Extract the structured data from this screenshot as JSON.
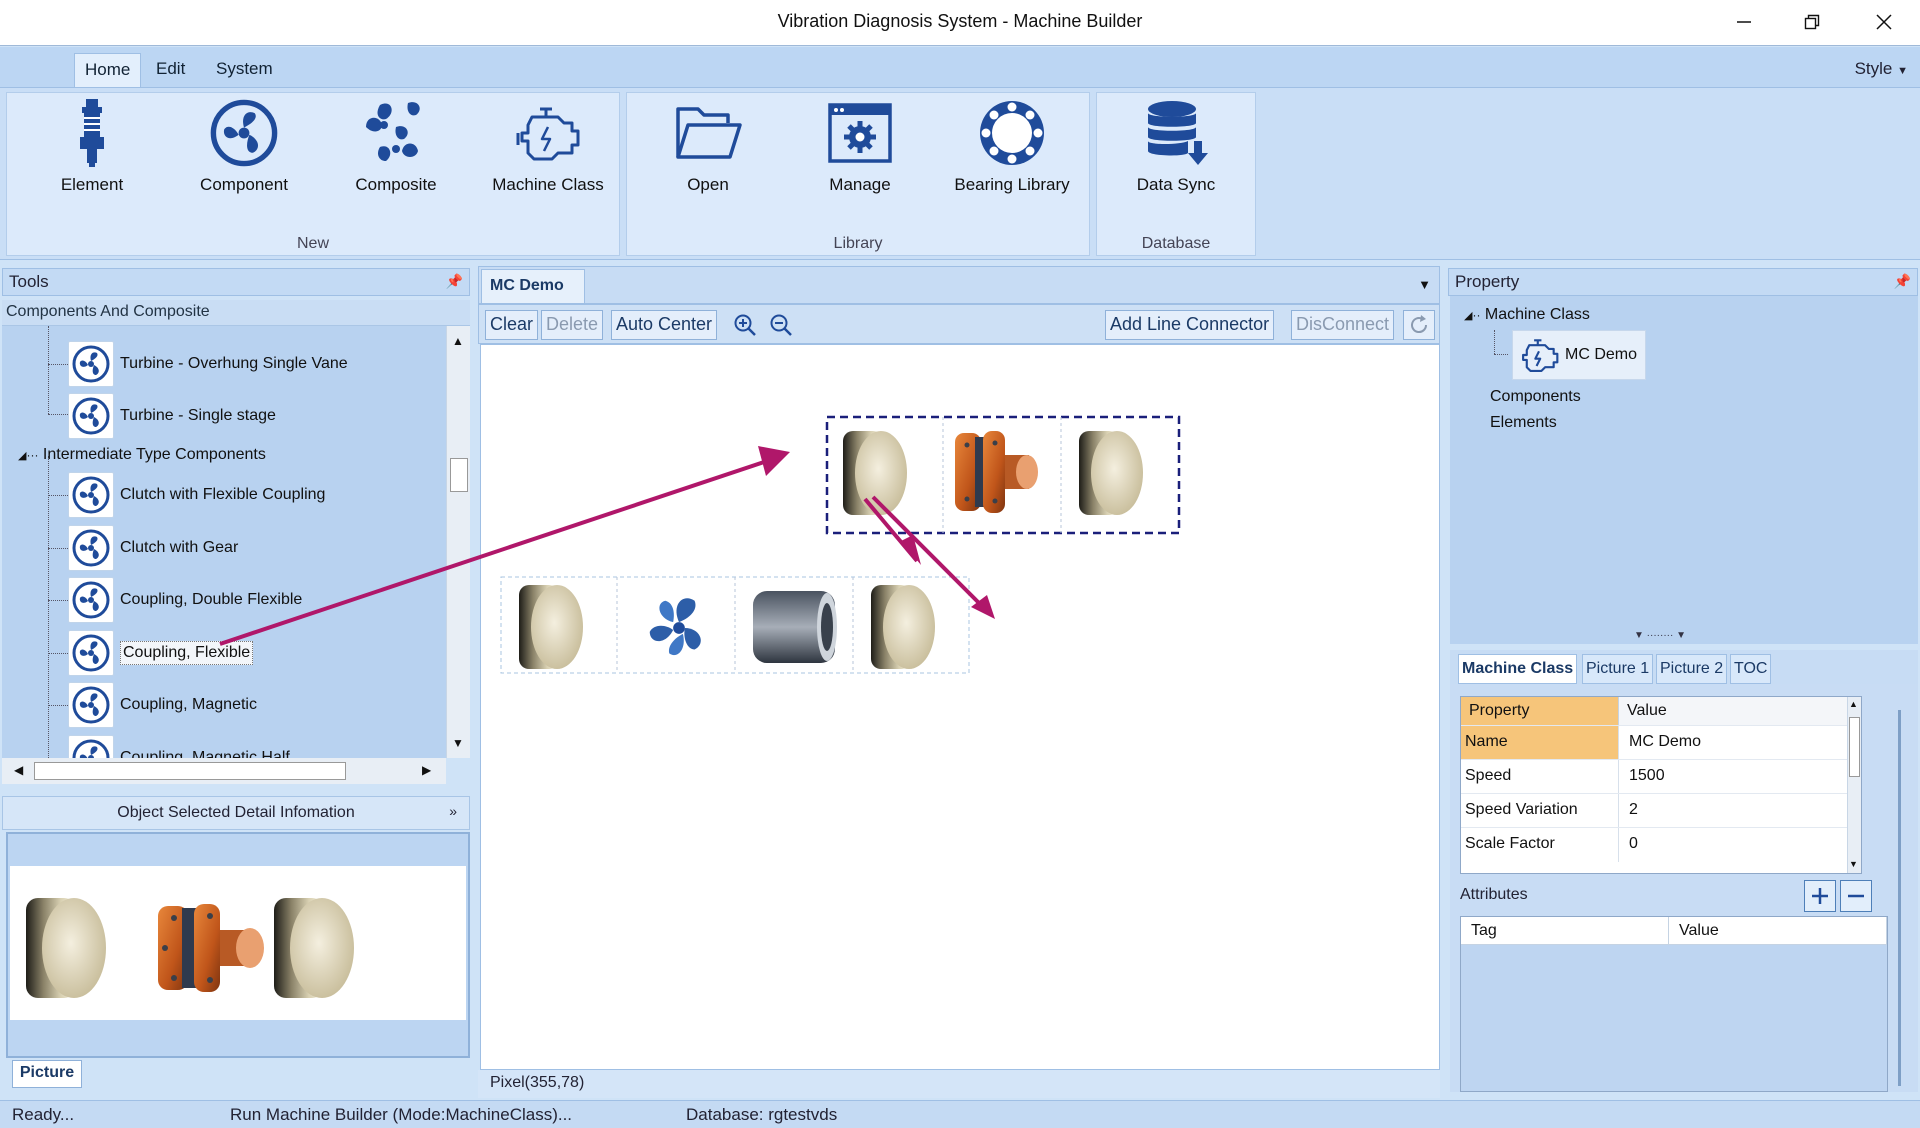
{
  "window": {
    "title": "Vibration Diagnosis System - Machine Builder"
  },
  "ribbon": {
    "tabs": [
      "Home",
      "Edit",
      "System"
    ],
    "style_label": "Style",
    "groups": [
      {
        "label": "New",
        "buttons": [
          "Element",
          "Component",
          "Composite",
          "Machine Class"
        ]
      },
      {
        "label": "Library",
        "buttons": [
          "Open",
          "Manage",
          "Bearing Library"
        ]
      },
      {
        "label": "Database",
        "buttons": [
          "Data Sync"
        ]
      }
    ]
  },
  "tools": {
    "title": "Tools",
    "section": "Components And Composite",
    "items": [
      "Turbine - Overhung Single Vane",
      "Turbine - Single stage",
      "Intermediate Type Components",
      "Clutch with Flexible Coupling",
      "Clutch with Gear",
      "Coupling, Double Flexible",
      "Coupling, Flexible",
      "Coupling, Magnetic",
      "Coupling, Magnetic Half"
    ],
    "selected_item": "Coupling, Flexible"
  },
  "detail": {
    "title": "Object Selected Detail Infomation",
    "tab": "Picture"
  },
  "document": {
    "tab": "MC Demo",
    "toolbar": {
      "clear": "Clear",
      "delete": "Delete",
      "auto_center": "Auto Center",
      "add_line_connector": "Add Line Connector",
      "disconnect": "DisConnect"
    },
    "pixel_readout": "Pixel(355,78)"
  },
  "property": {
    "title": "Property",
    "tree": {
      "root": "Machine Class",
      "child": "MC Demo",
      "components": "Components",
      "elements": "Elements"
    },
    "tabs": [
      "Machine Class",
      "Picture 1",
      "Picture 2",
      "TOC"
    ],
    "grid": {
      "headers": [
        "Property",
        "Value"
      ],
      "rows": [
        {
          "key": "Name",
          "value": "MC Demo"
        },
        {
          "key": "Speed",
          "value": "1500"
        },
        {
          "key": "Speed Variation",
          "value": "2"
        },
        {
          "key": "Scale Factor",
          "value": "0"
        }
      ]
    },
    "attributes_label": "Attributes",
    "attributes_headers": [
      "Tag",
      "Value"
    ]
  },
  "status": {
    "ready": "Ready...",
    "mode": "Run Machine Builder (Mode:MachineClass)...",
    "database": "Database: rgtestvds"
  },
  "colors": {
    "accent": "#1f4b9a",
    "arrow": "#b0176a",
    "ribbon": "#c9def6"
  }
}
